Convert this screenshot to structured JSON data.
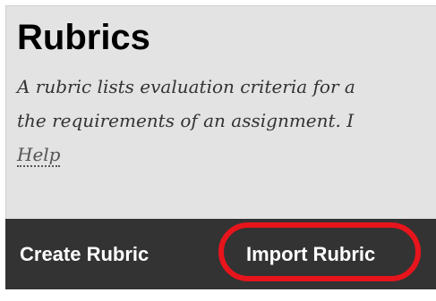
{
  "header": {
    "title": "Rubrics",
    "description_line1": "A rubric lists evaluation criteria for a",
    "description_line2": "the requirements of an assignment. I",
    "help_link": "Help"
  },
  "toolbar": {
    "create_label": "Create Rubric",
    "import_label": "Import Rubric"
  },
  "colors": {
    "header_bg": "#e3e3e3",
    "toolbar_bg": "#333333",
    "highlight": "#e8141c"
  }
}
